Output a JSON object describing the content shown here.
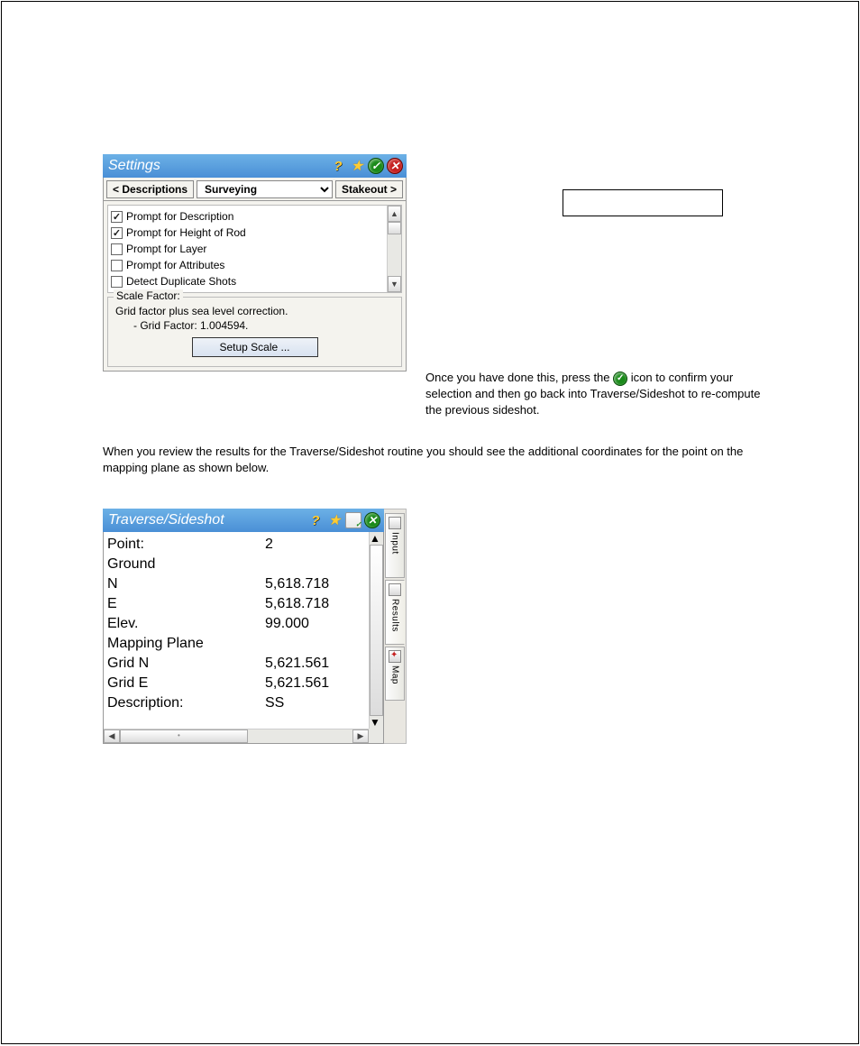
{
  "rightbox": "",
  "paragraphs": {
    "p1": "Once you have done this, press the  icon to confirm your selection and then go back into Traverse/Sideshot to re-compute the previous sideshot.",
    "p2": "When you review the results for the Traverse/Sideshot routine you should see the additional coordinates for the point on the mapping plane as shown below."
  },
  "settings": {
    "title": "Settings",
    "tab_prev": "< Descriptions",
    "tab_select": "Surveying",
    "tab_next": "Stakeout >",
    "checks": [
      {
        "label": "Prompt for Description",
        "checked": true
      },
      {
        "label": "Prompt for Height of Rod",
        "checked": true
      },
      {
        "label": "Prompt for Layer",
        "checked": false
      },
      {
        "label": "Prompt for Attributes",
        "checked": false
      },
      {
        "label": "Detect Duplicate Shots",
        "checked": false
      }
    ],
    "scale_legend": "Scale Factor:",
    "scale_line1": "Grid factor plus sea level correction.",
    "scale_line2": "- Grid Factor:   1.004594.",
    "setup_btn": "Setup Scale ..."
  },
  "traverse": {
    "title": "Traverse/Sideshot",
    "rows": [
      {
        "label": "Point:",
        "value": "2"
      },
      {
        "label": "Ground",
        "value": ""
      },
      {
        "label": " N",
        "value": "5,618.718"
      },
      {
        "label": " E",
        "value": "5,618.718"
      },
      {
        "label": " Elev.",
        "value": "99.000"
      },
      {
        "label": "Mapping Plane",
        "value": ""
      },
      {
        "label": " Grid N",
        "value": "5,621.561"
      },
      {
        "label": " Grid E",
        "value": "5,621.561"
      },
      {
        "label": "Description:",
        "value": "SS"
      }
    ],
    "sidetabs": {
      "input": "Input",
      "results": "Results",
      "map": "Map"
    }
  }
}
